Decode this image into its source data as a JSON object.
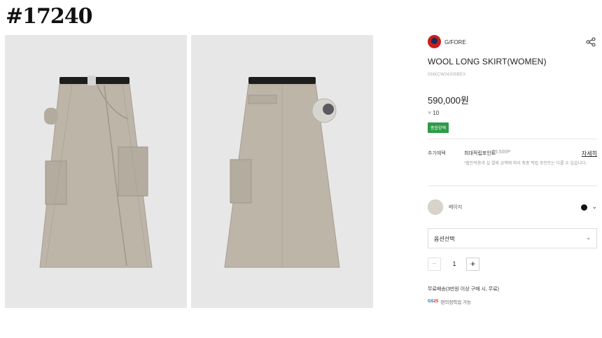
{
  "item_number": "#17240",
  "product": {
    "brand": "G/FORE",
    "title": "WOOL LONG SKIRT(WOMEN)",
    "sku": "GNKCW24305BEX",
    "price": "590,000원",
    "likes": "10",
    "badge": "종합양액"
  },
  "points": {
    "label": "추가혜택",
    "name": "최대적립포인트",
    "value": "29,500P",
    "detail_link": "자세히",
    "note": "*할인적용과 실 결제 금액에 따라 최종 적립 포인트는 다를 수 있습니다."
  },
  "color": {
    "label": "베이지",
    "selected_color": "#111111",
    "swatch_color": "#d8d4cc"
  },
  "option": {
    "label": "옵션선택"
  },
  "quantity": {
    "minus": "−",
    "value": "1",
    "plus": "+"
  },
  "shipping": {
    "text": "무료배송(3만원 이상 구매 시, 무료)",
    "gs_logo": "GS",
    "gs_logo_num": "25",
    "gs_pickup": "편의점픽업 가능"
  },
  "icons": {
    "share": "share-icon",
    "heart": "heart-icon",
    "chevron": "chevron-down-icon"
  }
}
